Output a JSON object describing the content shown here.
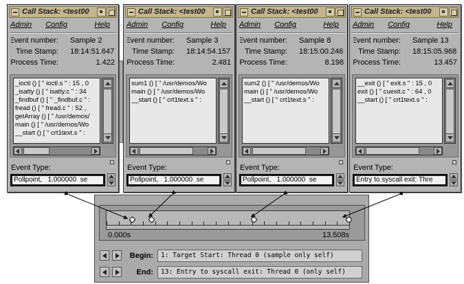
{
  "menu": {
    "admin": "Admin",
    "config": "Config",
    "help": "Help"
  },
  "labels": {
    "event_number": "Event number:",
    "time_stamp": "Time Stamp:",
    "process_time": "Process Time:",
    "event_type": "Event Type:"
  },
  "windows": [
    {
      "title": "Call Stack: <test00",
      "event_number": "Sample 2",
      "time_stamp": "18:14:51.647",
      "process_time": "1.422",
      "stack": [
        "_ioctl () [ \" ioctl.s \" : 15 , 0",
        "_isatty () [ \" isatty.c \" : 34",
        "_findbuf () [ \" _findbuf.c \" :",
        "fread () [ \" fread.c \" : 52 ,",
        "getArray () [ \" /usr/demos/",
        "main () [ \" /usr/demos/Wo",
        "__start () [ \" crt1text.s \" :"
      ],
      "event_type": "Pollpoint,   1.000000  se"
    },
    {
      "title": "Call Stack: <test00",
      "event_number": "Sample 3",
      "time_stamp": "18:14:54.157",
      "process_time": "2.481",
      "stack": [
        "sum1 () [ \" /usr/demos/Wo",
        "main () [ \" /usr/demos/Wo",
        "__start () [ \" crt1text.s \" :"
      ],
      "event_type": "Pollpoint,   1.000000  se"
    },
    {
      "title": "Call Stack: <test00",
      "event_number": "Sample 8",
      "time_stamp": "18:15:00.246",
      "process_time": "8.198",
      "stack": [
        "sum2 () [ \" /usr/demos/Wo",
        "main () [ \" /usr/demos/Wo",
        "__start () [ \" crt1text.s \" :"
      ],
      "event_type": "Pollpoint,   1.000000  se"
    },
    {
      "title": "Call Stack: <test00",
      "event_number": "Sample 13",
      "time_stamp": "18:15:05.968",
      "process_time": "13.457",
      "stack": [
        "__exit () [ \" exit.s \" : 15 , 0",
        "exit () [ \" cuexit.c \" : 64 , 0",
        "__start () [ \" crt1text.s \" :"
      ],
      "event_type": "Entry to syscall exit: Thre"
    }
  ],
  "timeline": {
    "start_label": "0.000s",
    "end_label": "13.508s",
    "range": [
      0,
      13.508
    ],
    "markers": [
      1.422,
      2.481,
      8.198,
      13.457
    ]
  },
  "begin": {
    "label": "Begin:",
    "value": "1: Target Start: Thread 0 (sample only self)"
  },
  "end": {
    "label": "End:",
    "value": "13: Entry to syscall exit: Thread 0 (only self)"
  }
}
